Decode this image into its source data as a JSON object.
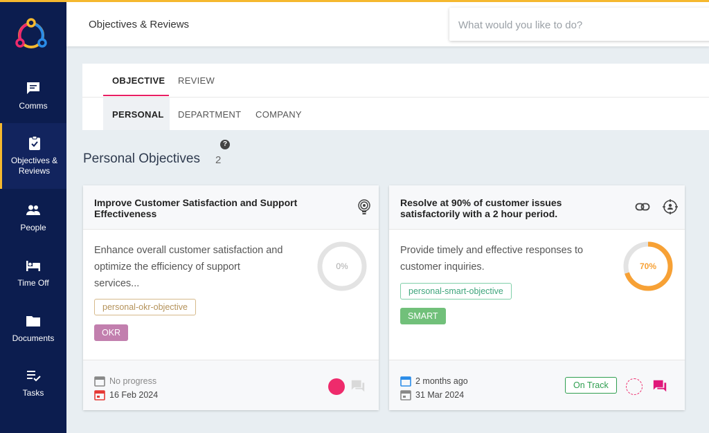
{
  "header": {
    "title": "Objectives & Reviews",
    "search_placeholder": "What would you like to do?"
  },
  "sidebar": {
    "items": [
      {
        "label": "Comms",
        "icon": "chat-icon"
      },
      {
        "label": "Objectives & Reviews",
        "icon": "clipboard-check-icon",
        "active": true
      },
      {
        "label": "People",
        "icon": "people-icon"
      },
      {
        "label": "Time Off",
        "icon": "bed-icon"
      },
      {
        "label": "Documents",
        "icon": "folder-icon"
      },
      {
        "label": "Tasks",
        "icon": "checklist-icon"
      }
    ]
  },
  "tabs": {
    "main": [
      "OBJECTIVE",
      "REVIEW"
    ],
    "active_main": "OBJECTIVE",
    "sub": [
      "PERSONAL",
      "DEPARTMENT",
      "COMPANY"
    ],
    "active_sub": "PERSONAL"
  },
  "section": {
    "title": "Personal Objectives",
    "count": "2",
    "help": "?"
  },
  "cards": [
    {
      "title": "Improve Customer Satisfaction and Support Effectiveness",
      "description": "Enhance overall customer satisfaction and optimize the efficiency of support services...",
      "progress": 0,
      "progress_label": "0%",
      "tag": "personal-okr-objective",
      "type": "OKR",
      "status_text": "No progress",
      "date": "16 Feb 2024",
      "colors": {
        "tag": "#c9a36b",
        "pill": "#c27fae",
        "ring": "#e3e3e3",
        "dot": "#ee2b6c"
      }
    },
    {
      "title": "Resolve at 90% of customer issues satisfactorily with a 2 hour period.",
      "description": "Provide timely and effective responses to customer inquiries.",
      "progress": 70,
      "progress_label": "70%",
      "tag": "personal-smart-objective",
      "type": "SMART",
      "status_text": "2 months ago",
      "date": "31 Mar 2024",
      "badge": "On Track",
      "colors": {
        "tag": "#45b68a",
        "pill": "#71c07a",
        "ring": "#f7a135",
        "dot": "#ee2b6c"
      }
    }
  ],
  "colors": {
    "sidebar": "#0c1d4f",
    "accent": "#e91e63",
    "highlight": "#f5b82e"
  }
}
